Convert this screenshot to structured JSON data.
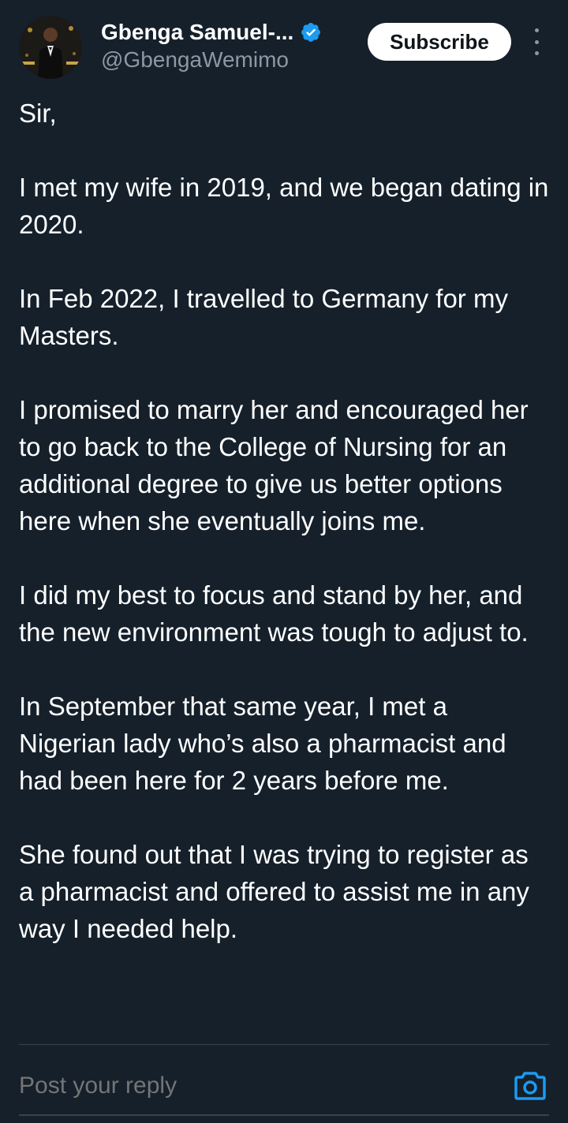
{
  "author": {
    "display_name": "Gbenga Samuel-...",
    "handle": "@GbengaWemimo",
    "verified": true,
    "avatar_icon": "profile-photo"
  },
  "header": {
    "subscribe_label": "Subscribe",
    "more_icon": "vertical-ellipsis-icon"
  },
  "post": {
    "paragraphs": [
      "Sir,",
      "I met my wife in 2019, and we began dating in 2020.",
      "In Feb 2022, I travelled to Germany for my Masters.",
      "I promised to marry her and encouraged her to go back to the College of Nursing for an additional degree to give us better options here when she eventually joins me.",
      "I did my best to focus and stand by her, and the new environment was tough to adjust to.",
      "In September that same year, I met a Nigerian lady who’s also a pharmacist and had been here for 2 years before me.",
      "She found out that I was trying to register as a pharmacist and offered to assist me in any way I needed help."
    ]
  },
  "reply": {
    "placeholder": "Post your reply",
    "camera_icon": "camera-icon"
  },
  "colors": {
    "background": "#15202b",
    "text": "#ffffff",
    "secondary_text": "#8b98a5",
    "accent": "#1d9bf0",
    "divider": "#38444d"
  }
}
